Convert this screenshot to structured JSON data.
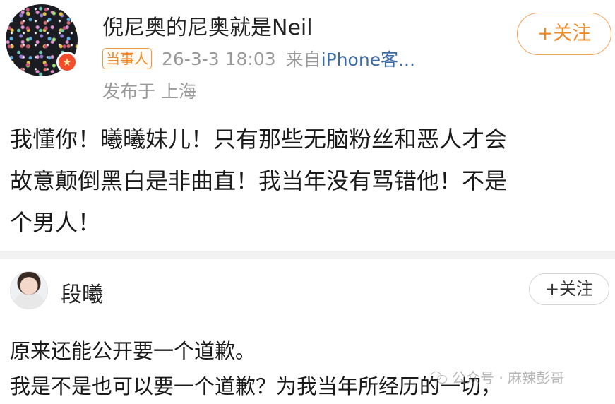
{
  "post": {
    "username": "倪尼奥的尼奥就是Neil",
    "tag": "当事人",
    "time": "26-3-3 18:03",
    "source_label": "来自",
    "source": "iPhone客...",
    "location": "发布于 上海",
    "follow_label": "+关注",
    "badge_icon": "star-icon",
    "text_lines": [
      "我懂你！曦曦妹儿！只有那些无脑粉丝和恶人才会",
      "故意颠倒黑白是非曲直！我当年没有骂错他！不是",
      "个男人！"
    ]
  },
  "comment": {
    "username": "段曦",
    "follow_label": "+关注",
    "text_lines": [
      "原来还能公开要一个道歉。",
      "我是不是也可以要一个道歉？为我当年所经历的一切，"
    ]
  },
  "watermark": "公众号 · 麻辣彭哥",
  "colors": {
    "accent_orange": "#ef8a26",
    "link_blue": "#3b6ba8",
    "meta_gray": "#9a9a9a"
  }
}
